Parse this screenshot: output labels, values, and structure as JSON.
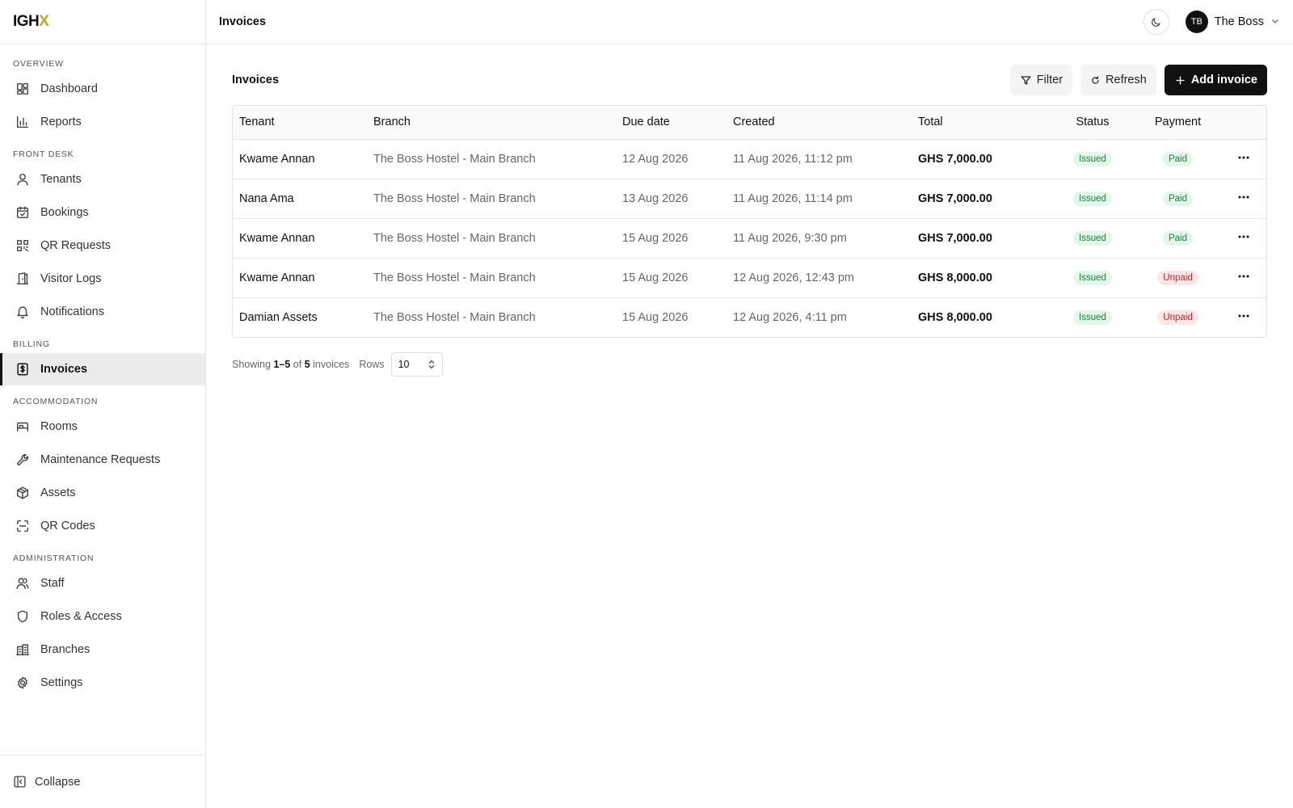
{
  "brand": {
    "text": "IGH",
    "accent": "X"
  },
  "sidebar": {
    "sections": [
      {
        "label": "OVERVIEW",
        "items": [
          {
            "label": "Dashboard",
            "icon": "dashboard-icon"
          },
          {
            "label": "Reports",
            "icon": "bar-chart-icon"
          }
        ]
      },
      {
        "label": "FRONT DESK",
        "items": [
          {
            "label": "Tenants",
            "icon": "user-icon"
          },
          {
            "label": "Bookings",
            "icon": "calendar-check-icon"
          },
          {
            "label": "QR Requests",
            "icon": "qr-icon"
          },
          {
            "label": "Visitor Logs",
            "icon": "door-icon"
          },
          {
            "label": "Notifications",
            "icon": "bell-icon"
          }
        ]
      },
      {
        "label": "BILLING",
        "items": [
          {
            "label": "Invoices",
            "icon": "invoice-icon",
            "active": true
          }
        ]
      },
      {
        "label": "ACCOMMODATION",
        "items": [
          {
            "label": "Rooms",
            "icon": "bed-icon"
          },
          {
            "label": "Maintenance Requests",
            "icon": "wrench-icon"
          },
          {
            "label": "Assets",
            "icon": "box-icon"
          },
          {
            "label": "QR Codes",
            "icon": "scan-icon"
          }
        ]
      },
      {
        "label": "ADMINISTRATION",
        "items": [
          {
            "label": "Staff",
            "icon": "users-icon"
          },
          {
            "label": "Roles & Access",
            "icon": "shield-icon"
          },
          {
            "label": "Branches",
            "icon": "building-icon"
          },
          {
            "label": "Settings",
            "icon": "gear-icon"
          }
        ]
      }
    ],
    "collapse_label": "Collapse"
  },
  "topbar": {
    "title": "Invoices",
    "user_initials": "TB",
    "user_name": "The Boss"
  },
  "content": {
    "title": "Invoices",
    "filter_label": "Filter",
    "refresh_label": "Refresh",
    "add_label": "Add invoice"
  },
  "table": {
    "columns": [
      "Tenant",
      "Branch",
      "Due date",
      "Created",
      "Total",
      "Status",
      "Payment"
    ],
    "rows": [
      {
        "tenant": "Kwame Annan",
        "branch": "The Boss Hostel - Main Branch",
        "due": "12 Aug 2026",
        "created": "11 Aug 2026, 11:12 pm",
        "total": "GHS 7,000.00",
        "status": "Issued",
        "payment": "Paid"
      },
      {
        "tenant": "Nana Ama",
        "branch": "The Boss Hostel - Main Branch",
        "due": "13 Aug 2026",
        "created": "11 Aug 2026, 11:14 pm",
        "total": "GHS 7,000.00",
        "status": "Issued",
        "payment": "Paid"
      },
      {
        "tenant": "Kwame Annan",
        "branch": "The Boss Hostel - Main Branch",
        "due": "15 Aug 2026",
        "created": "11 Aug 2026, 9:30 pm",
        "total": "GHS 7,000.00",
        "status": "Issued",
        "payment": "Paid"
      },
      {
        "tenant": "Kwame Annan",
        "branch": "The Boss Hostel - Main Branch",
        "due": "15 Aug 2026",
        "created": "12 Aug 2026, 12:43 pm",
        "total": "GHS 8,000.00",
        "status": "Issued",
        "payment": "Unpaid"
      },
      {
        "tenant": "Damian Assets",
        "branch": "The Boss Hostel - Main Branch",
        "due": "15 Aug 2026",
        "created": "12 Aug 2026, 4:11 pm",
        "total": "GHS 8,000.00",
        "status": "Issued",
        "payment": "Unpaid"
      }
    ]
  },
  "pager": {
    "showing_prefix": "Showing",
    "range": "1–5",
    "of_text": "of",
    "total": "5",
    "suffix": "invoices",
    "rows_label": "Rows",
    "rows_value": "10"
  },
  "colors": {
    "accent": "#111111",
    "brand_x": "#c9a227",
    "paid": "#17803d",
    "unpaid": "#c0262d"
  }
}
